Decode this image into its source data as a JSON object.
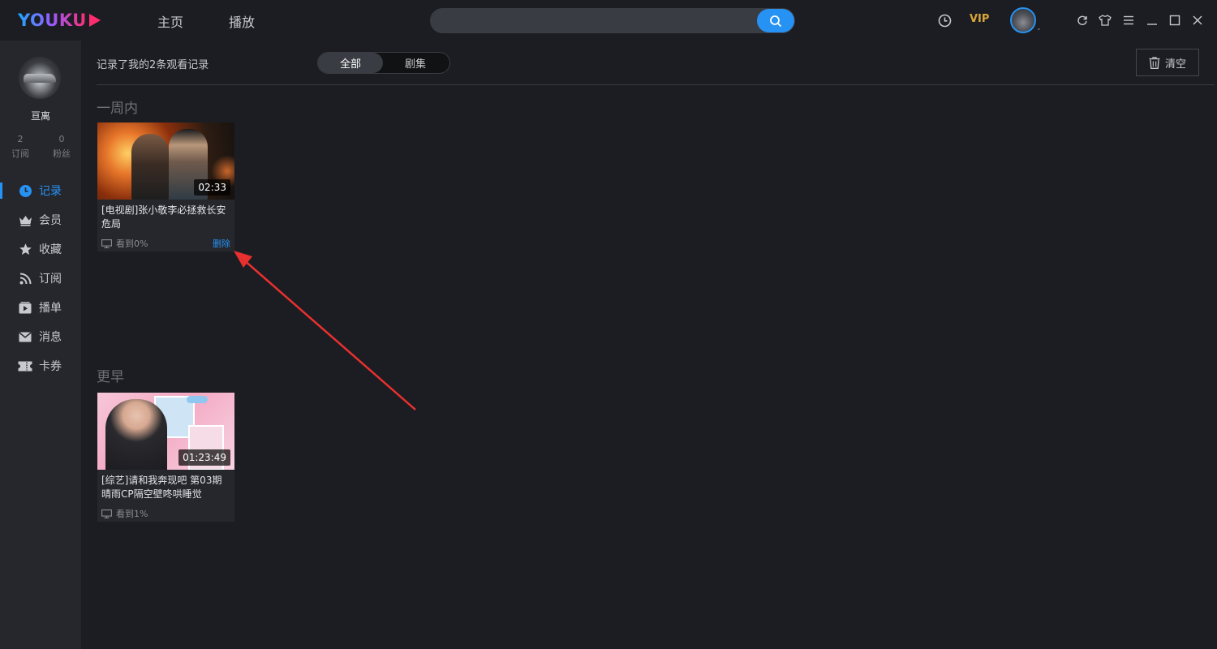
{
  "titlebar": {
    "logo_text": "YOUKU",
    "nav": [
      "主页",
      "播放"
    ],
    "search_placeholder": "",
    "vip_label": "VIP"
  },
  "sidebar": {
    "username": "亘离",
    "stats": [
      {
        "count": "2",
        "label": "订阅"
      },
      {
        "count": "0",
        "label": "粉丝"
      }
    ],
    "menu": [
      {
        "label": "记录",
        "icon": "clock-icon",
        "active": true
      },
      {
        "label": "会员",
        "icon": "crown-icon"
      },
      {
        "label": "收藏",
        "icon": "star-icon"
      },
      {
        "label": "订阅",
        "icon": "rss-icon"
      },
      {
        "label": "播单",
        "icon": "playlist-icon"
      },
      {
        "label": "消息",
        "icon": "mail-icon"
      },
      {
        "label": "卡券",
        "icon": "ticket-icon"
      }
    ]
  },
  "history": {
    "summary": "记录了我的2条观看记录",
    "filters": [
      {
        "label": "全部",
        "selected": true
      },
      {
        "label": "剧集",
        "selected": false
      }
    ],
    "clear_label": "清空",
    "sections": [
      {
        "title": "一周内",
        "items": [
          {
            "title": "[电视剧]张小敬李必拯救长安危局",
            "duration": "02:33",
            "progress": "看到0%",
            "delete_label": "删除"
          }
        ]
      },
      {
        "title": "更早",
        "items": [
          {
            "title": "[综艺]请和我奔现吧 第03期 晴雨CP隔空壁咚哄睡觉",
            "duration": "01:23:49",
            "progress": "看到1%"
          }
        ]
      }
    ]
  },
  "colors": {
    "accent": "#2692f4",
    "vip": "#d9a53b",
    "annotation_arrow": "#e8302f"
  }
}
